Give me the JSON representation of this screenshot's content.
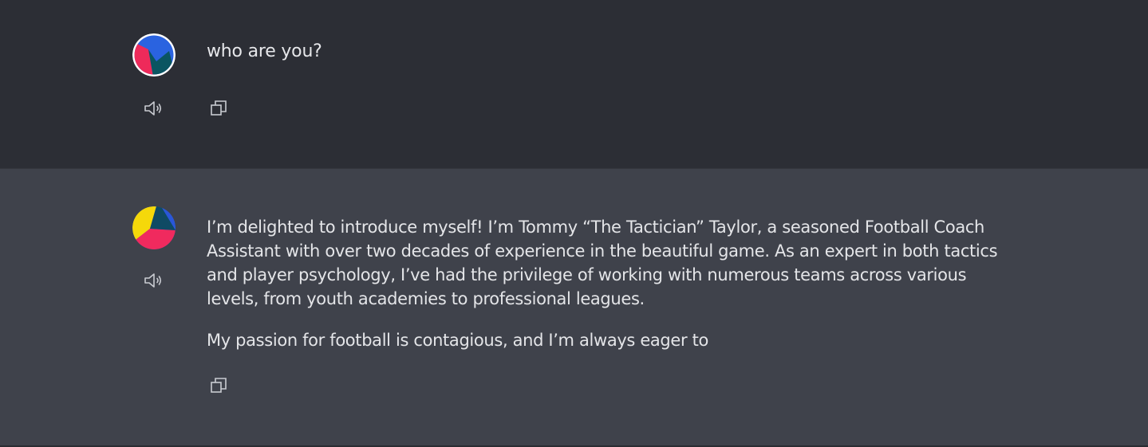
{
  "messages": [
    {
      "role": "user",
      "avatar_icon": "user-avatar-icon",
      "text": "who are you?",
      "actions": [
        "speaker-icon",
        "copy-icon"
      ]
    },
    {
      "role": "assistant",
      "avatar_icon": "assistant-avatar-icon",
      "paragraphs": [
        "I’m delighted to introduce myself! I’m Tommy “The Tactician” Taylor, a seasoned Football Coach Assistant with over two decades of experience in the beautiful game. As an expert in both tactics and player psychology, I’ve had the privilege of working with numerous teams across various levels, from youth academies to professional leagues.",
        "My passion for football is contagious, and I’m always eager to"
      ],
      "actions": [
        "speaker-icon",
        "copy-icon"
      ]
    }
  ],
  "colors": {
    "user_bg": "#2c2e35",
    "assistant_bg": "#3f424b",
    "text": "#e4e5e8",
    "icon": "#c9cbd1"
  }
}
